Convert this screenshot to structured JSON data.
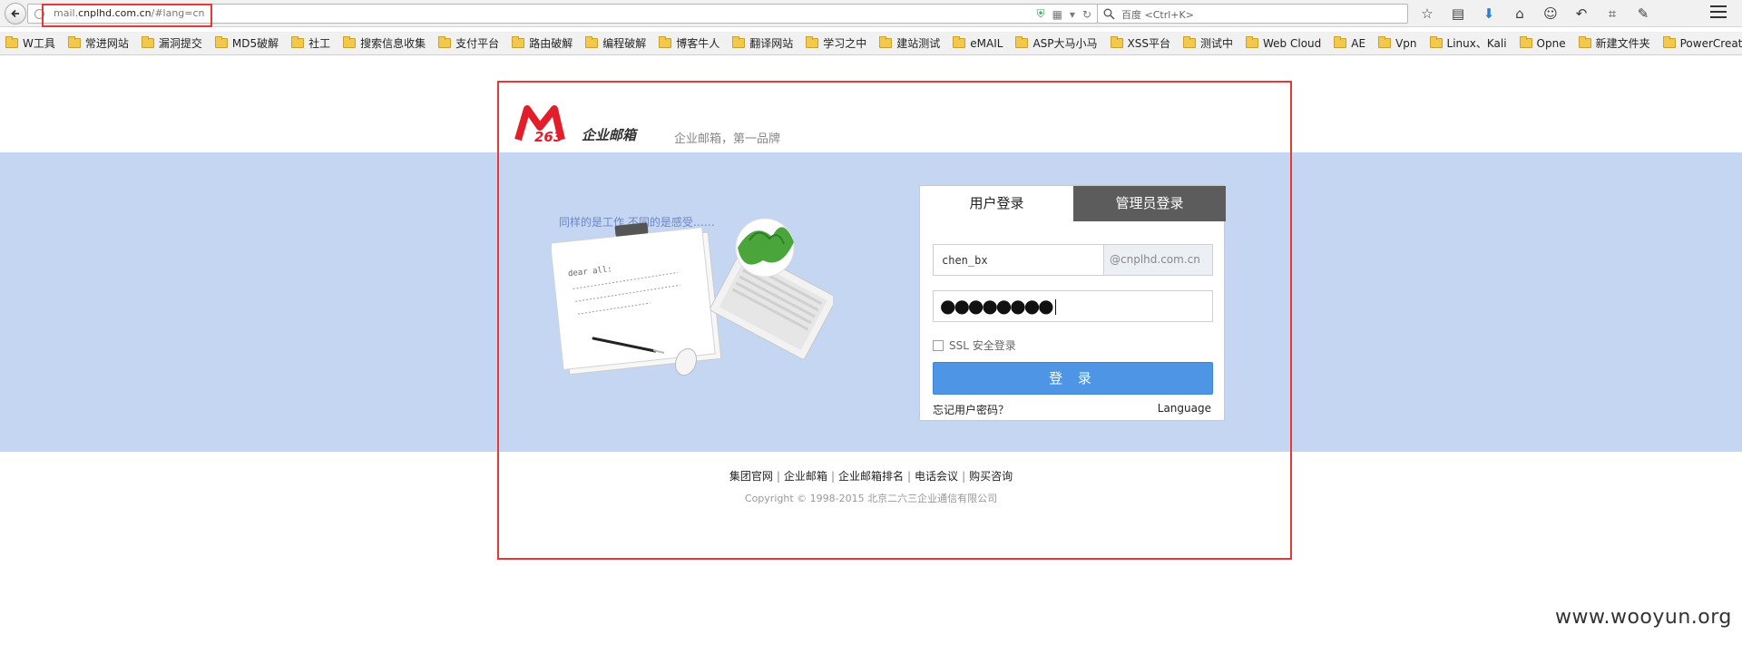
{
  "browser": {
    "url_prefix": "mail.",
    "url_domain": "cnplhd.com.cn",
    "url_suffix": "/#lang=cn",
    "search_placeholder": "百度 <Ctrl+K>"
  },
  "bookmarks": [
    "W工具",
    "常进网站",
    "漏洞提交",
    "MD5破解",
    "社工",
    "搜索信息收集",
    "支付平台",
    "路由破解",
    "编程破解",
    "博客牛人",
    "翻译网站",
    "学习之中",
    "建站测试",
    "eMAIL",
    "ASP大马小马",
    "XSS平台",
    "测试中",
    "Web Cloud",
    "AE",
    "Vpn",
    "Linux、Kali",
    "Opne",
    "新建文件夹",
    "PowerCreator CMS"
  ],
  "brand": {
    "logo_text": "企业邮箱",
    "slogan": "企业邮箱，第一品牌",
    "tagline": "同样的是工作,不同的是感受……",
    "letter_greeting": "dear all:",
    "accent": "#e11e2a"
  },
  "login": {
    "tab_user": "用户登录",
    "tab_admin": "管理员登录",
    "username": "chen_bx",
    "domain": "@cnplhd.com.cn",
    "password_mask": "●●●●●●●●",
    "ssl_label": "SSL  安全登录",
    "submit": "登 录",
    "forgot": "忘记用户密码？",
    "language": "Language"
  },
  "footer": {
    "links": [
      "集团官网",
      "企业邮箱",
      "企业邮箱排名",
      "电话会议",
      "购买咨询"
    ],
    "copyright": "Copyright © 1998-2015 北京二六三企业通信有限公司"
  },
  "watermark": "www.wooyun.org"
}
